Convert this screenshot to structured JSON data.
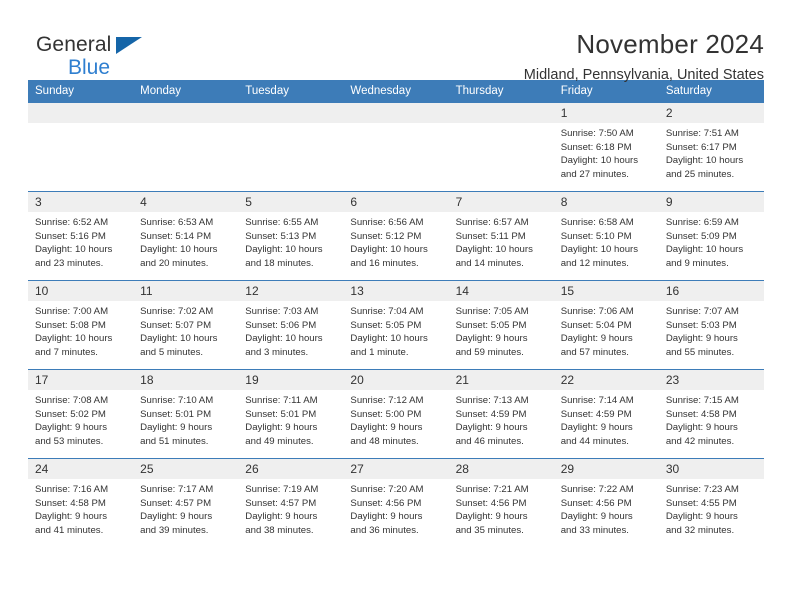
{
  "brand": {
    "name_part1": "General",
    "name_part2": "Blue",
    "triangle_color": "#1565a8",
    "blue_text_color": "#2f7fd0"
  },
  "header": {
    "title": "November 2024",
    "subtitle": "Midland, Pennsylvania, United States"
  },
  "theme": {
    "header_blue": "#3d7cb8",
    "daynum_band": "#efefef",
    "text": "#333333"
  },
  "weekday_headers": [
    "Sunday",
    "Monday",
    "Tuesday",
    "Wednesday",
    "Thursday",
    "Friday",
    "Saturday"
  ],
  "labels": {
    "sunrise_prefix": "Sunrise:",
    "sunset_prefix": "Sunset:",
    "daylight_prefix": "Daylight:"
  },
  "weeks": [
    [
      {
        "day": "",
        "empty": true
      },
      {
        "day": "",
        "empty": true
      },
      {
        "day": "",
        "empty": true
      },
      {
        "day": "",
        "empty": true
      },
      {
        "day": "",
        "empty": true
      },
      {
        "day": "1",
        "sunrise": "Sunrise: 7:50 AM",
        "sunset": "Sunset: 6:18 PM",
        "daylight_line1": "Daylight: 10 hours",
        "daylight_line2": "and 27 minutes."
      },
      {
        "day": "2",
        "sunrise": "Sunrise: 7:51 AM",
        "sunset": "Sunset: 6:17 PM",
        "daylight_line1": "Daylight: 10 hours",
        "daylight_line2": "and 25 minutes."
      }
    ],
    [
      {
        "day": "3",
        "sunrise": "Sunrise: 6:52 AM",
        "sunset": "Sunset: 5:16 PM",
        "daylight_line1": "Daylight: 10 hours",
        "daylight_line2": "and 23 minutes."
      },
      {
        "day": "4",
        "sunrise": "Sunrise: 6:53 AM",
        "sunset": "Sunset: 5:14 PM",
        "daylight_line1": "Daylight: 10 hours",
        "daylight_line2": "and 20 minutes."
      },
      {
        "day": "5",
        "sunrise": "Sunrise: 6:55 AM",
        "sunset": "Sunset: 5:13 PM",
        "daylight_line1": "Daylight: 10 hours",
        "daylight_line2": "and 18 minutes."
      },
      {
        "day": "6",
        "sunrise": "Sunrise: 6:56 AM",
        "sunset": "Sunset: 5:12 PM",
        "daylight_line1": "Daylight: 10 hours",
        "daylight_line2": "and 16 minutes."
      },
      {
        "day": "7",
        "sunrise": "Sunrise: 6:57 AM",
        "sunset": "Sunset: 5:11 PM",
        "daylight_line1": "Daylight: 10 hours",
        "daylight_line2": "and 14 minutes."
      },
      {
        "day": "8",
        "sunrise": "Sunrise: 6:58 AM",
        "sunset": "Sunset: 5:10 PM",
        "daylight_line1": "Daylight: 10 hours",
        "daylight_line2": "and 12 minutes."
      },
      {
        "day": "9",
        "sunrise": "Sunrise: 6:59 AM",
        "sunset": "Sunset: 5:09 PM",
        "daylight_line1": "Daylight: 10 hours",
        "daylight_line2": "and 9 minutes."
      }
    ],
    [
      {
        "day": "10",
        "sunrise": "Sunrise: 7:00 AM",
        "sunset": "Sunset: 5:08 PM",
        "daylight_line1": "Daylight: 10 hours",
        "daylight_line2": "and 7 minutes."
      },
      {
        "day": "11",
        "sunrise": "Sunrise: 7:02 AM",
        "sunset": "Sunset: 5:07 PM",
        "daylight_line1": "Daylight: 10 hours",
        "daylight_line2": "and 5 minutes."
      },
      {
        "day": "12",
        "sunrise": "Sunrise: 7:03 AM",
        "sunset": "Sunset: 5:06 PM",
        "daylight_line1": "Daylight: 10 hours",
        "daylight_line2": "and 3 minutes."
      },
      {
        "day": "13",
        "sunrise": "Sunrise: 7:04 AM",
        "sunset": "Sunset: 5:05 PM",
        "daylight_line1": "Daylight: 10 hours",
        "daylight_line2": "and 1 minute."
      },
      {
        "day": "14",
        "sunrise": "Sunrise: 7:05 AM",
        "sunset": "Sunset: 5:05 PM",
        "daylight_line1": "Daylight: 9 hours",
        "daylight_line2": "and 59 minutes."
      },
      {
        "day": "15",
        "sunrise": "Sunrise: 7:06 AM",
        "sunset": "Sunset: 5:04 PM",
        "daylight_line1": "Daylight: 9 hours",
        "daylight_line2": "and 57 minutes."
      },
      {
        "day": "16",
        "sunrise": "Sunrise: 7:07 AM",
        "sunset": "Sunset: 5:03 PM",
        "daylight_line1": "Daylight: 9 hours",
        "daylight_line2": "and 55 minutes."
      }
    ],
    [
      {
        "day": "17",
        "sunrise": "Sunrise: 7:08 AM",
        "sunset": "Sunset: 5:02 PM",
        "daylight_line1": "Daylight: 9 hours",
        "daylight_line2": "and 53 minutes."
      },
      {
        "day": "18",
        "sunrise": "Sunrise: 7:10 AM",
        "sunset": "Sunset: 5:01 PM",
        "daylight_line1": "Daylight: 9 hours",
        "daylight_line2": "and 51 minutes."
      },
      {
        "day": "19",
        "sunrise": "Sunrise: 7:11 AM",
        "sunset": "Sunset: 5:01 PM",
        "daylight_line1": "Daylight: 9 hours",
        "daylight_line2": "and 49 minutes."
      },
      {
        "day": "20",
        "sunrise": "Sunrise: 7:12 AM",
        "sunset": "Sunset: 5:00 PM",
        "daylight_line1": "Daylight: 9 hours",
        "daylight_line2": "and 48 minutes."
      },
      {
        "day": "21",
        "sunrise": "Sunrise: 7:13 AM",
        "sunset": "Sunset: 4:59 PM",
        "daylight_line1": "Daylight: 9 hours",
        "daylight_line2": "and 46 minutes."
      },
      {
        "day": "22",
        "sunrise": "Sunrise: 7:14 AM",
        "sunset": "Sunset: 4:59 PM",
        "daylight_line1": "Daylight: 9 hours",
        "daylight_line2": "and 44 minutes."
      },
      {
        "day": "23",
        "sunrise": "Sunrise: 7:15 AM",
        "sunset": "Sunset: 4:58 PM",
        "daylight_line1": "Daylight: 9 hours",
        "daylight_line2": "and 42 minutes."
      }
    ],
    [
      {
        "day": "24",
        "sunrise": "Sunrise: 7:16 AM",
        "sunset": "Sunset: 4:58 PM",
        "daylight_line1": "Daylight: 9 hours",
        "daylight_line2": "and 41 minutes."
      },
      {
        "day": "25",
        "sunrise": "Sunrise: 7:17 AM",
        "sunset": "Sunset: 4:57 PM",
        "daylight_line1": "Daylight: 9 hours",
        "daylight_line2": "and 39 minutes."
      },
      {
        "day": "26",
        "sunrise": "Sunrise: 7:19 AM",
        "sunset": "Sunset: 4:57 PM",
        "daylight_line1": "Daylight: 9 hours",
        "daylight_line2": "and 38 minutes."
      },
      {
        "day": "27",
        "sunrise": "Sunrise: 7:20 AM",
        "sunset": "Sunset: 4:56 PM",
        "daylight_line1": "Daylight: 9 hours",
        "daylight_line2": "and 36 minutes."
      },
      {
        "day": "28",
        "sunrise": "Sunrise: 7:21 AM",
        "sunset": "Sunset: 4:56 PM",
        "daylight_line1": "Daylight: 9 hours",
        "daylight_line2": "and 35 minutes."
      },
      {
        "day": "29",
        "sunrise": "Sunrise: 7:22 AM",
        "sunset": "Sunset: 4:56 PM",
        "daylight_line1": "Daylight: 9 hours",
        "daylight_line2": "and 33 minutes."
      },
      {
        "day": "30",
        "sunrise": "Sunrise: 7:23 AM",
        "sunset": "Sunset: 4:55 PM",
        "daylight_line1": "Daylight: 9 hours",
        "daylight_line2": "and 32 minutes."
      }
    ]
  ]
}
